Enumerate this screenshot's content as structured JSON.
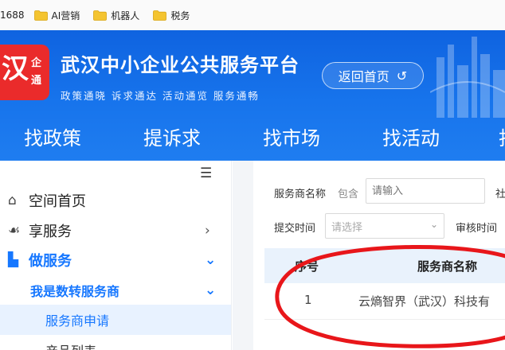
{
  "bookmarks": [
    {
      "label": "1688",
      "icon": "none"
    },
    {
      "label": "AI营销",
      "icon": "folder-icon"
    },
    {
      "label": "机器人",
      "icon": "folder-icon"
    },
    {
      "label": "税务",
      "icon": "folder-icon"
    }
  ],
  "header": {
    "logo": {
      "big": "汉",
      "small_top": "企",
      "small_bottom": "通"
    },
    "title": "武汉中小企业公共服务平台",
    "subtitle": "政策通晓  诉求通达  活动通览  服务通畅",
    "back_home": "返回首页",
    "back_icon": "return-arrow-icon"
  },
  "nav": {
    "items": [
      "找政策",
      "提诉求",
      "找市场",
      "找活动",
      "找"
    ]
  },
  "sidebar": {
    "toggle_icon": "hamburger-menu-icon",
    "items": [
      {
        "label": "空间首页",
        "icon": "home-icon"
      },
      {
        "label": "享服务",
        "icon": "hand-icon",
        "arrow": "›"
      },
      {
        "label": "做服务",
        "icon": "building-icon",
        "arrow": "⌄"
      }
    ],
    "submenu": {
      "label": "我是数转服务商",
      "arrow": "⌄"
    },
    "leaves": [
      {
        "label": "服务商申请",
        "selected": true
      },
      {
        "label": "产品列表",
        "selected": false
      }
    ]
  },
  "filters": {
    "name_label": "服务商名称",
    "match_mode": "包含",
    "name_placeholder": "请输入",
    "truncated_label": "社",
    "submit_time_label": "提交时间",
    "submit_time_placeholder": "请选择",
    "review_time_label": "审核时间"
  },
  "table": {
    "columns": [
      "序号",
      "服务商名称"
    ],
    "rows": [
      {
        "index": "1",
        "name": "云熵智界（武汉）科技有"
      }
    ]
  },
  "colors": {
    "header_blue": "#1774ec",
    "accent_blue": "#1677ff",
    "logo_red": "#ea2b2b",
    "annotation_red": "#e8161a"
  }
}
